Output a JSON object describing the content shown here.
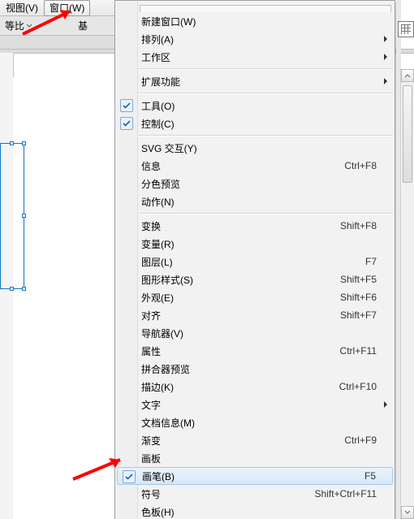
{
  "menubar": {
    "view": "视图(V)",
    "window": "窗口(W)"
  },
  "optionbar": {
    "ratio": "等比",
    "basic_prefix": "基"
  },
  "menu": {
    "new_window": "新建窗口(W)",
    "arrange": "排列(A)",
    "workspace": "工作区",
    "extensions": "扩展功能",
    "tools": "工具(O)",
    "control": "控制(C)",
    "svg": "SVG 交互(Y)",
    "info": "信息",
    "sep_preview": "分色预览",
    "actions": "动作(N)",
    "transform": "变换",
    "variables": "变量(R)",
    "layers": "图层(L)",
    "graphic_styles": "图形样式(S)",
    "appearance": "外观(E)",
    "align": "对齐",
    "navigator": "导航器(V)",
    "attributes": "属性",
    "flattener": "拼合器预览",
    "stroke": "描边(K)",
    "type": "文字",
    "doc_info": "文档信息(M)",
    "gradient": "渐变",
    "artboards": "画板",
    "brushes": "画笔(B)",
    "symbols": "符号",
    "swatches": "色板(H)"
  },
  "shortcut": {
    "info": "Ctrl+F8",
    "transform": "Shift+F8",
    "layers": "F7",
    "graphic_styles": "Shift+F5",
    "appearance": "Shift+F6",
    "align": "Shift+F7",
    "attributes": "Ctrl+F11",
    "stroke": "Ctrl+F10",
    "gradient": "Ctrl+F9",
    "brushes": "F5",
    "symbols": "Shift+Ctrl+F11"
  }
}
